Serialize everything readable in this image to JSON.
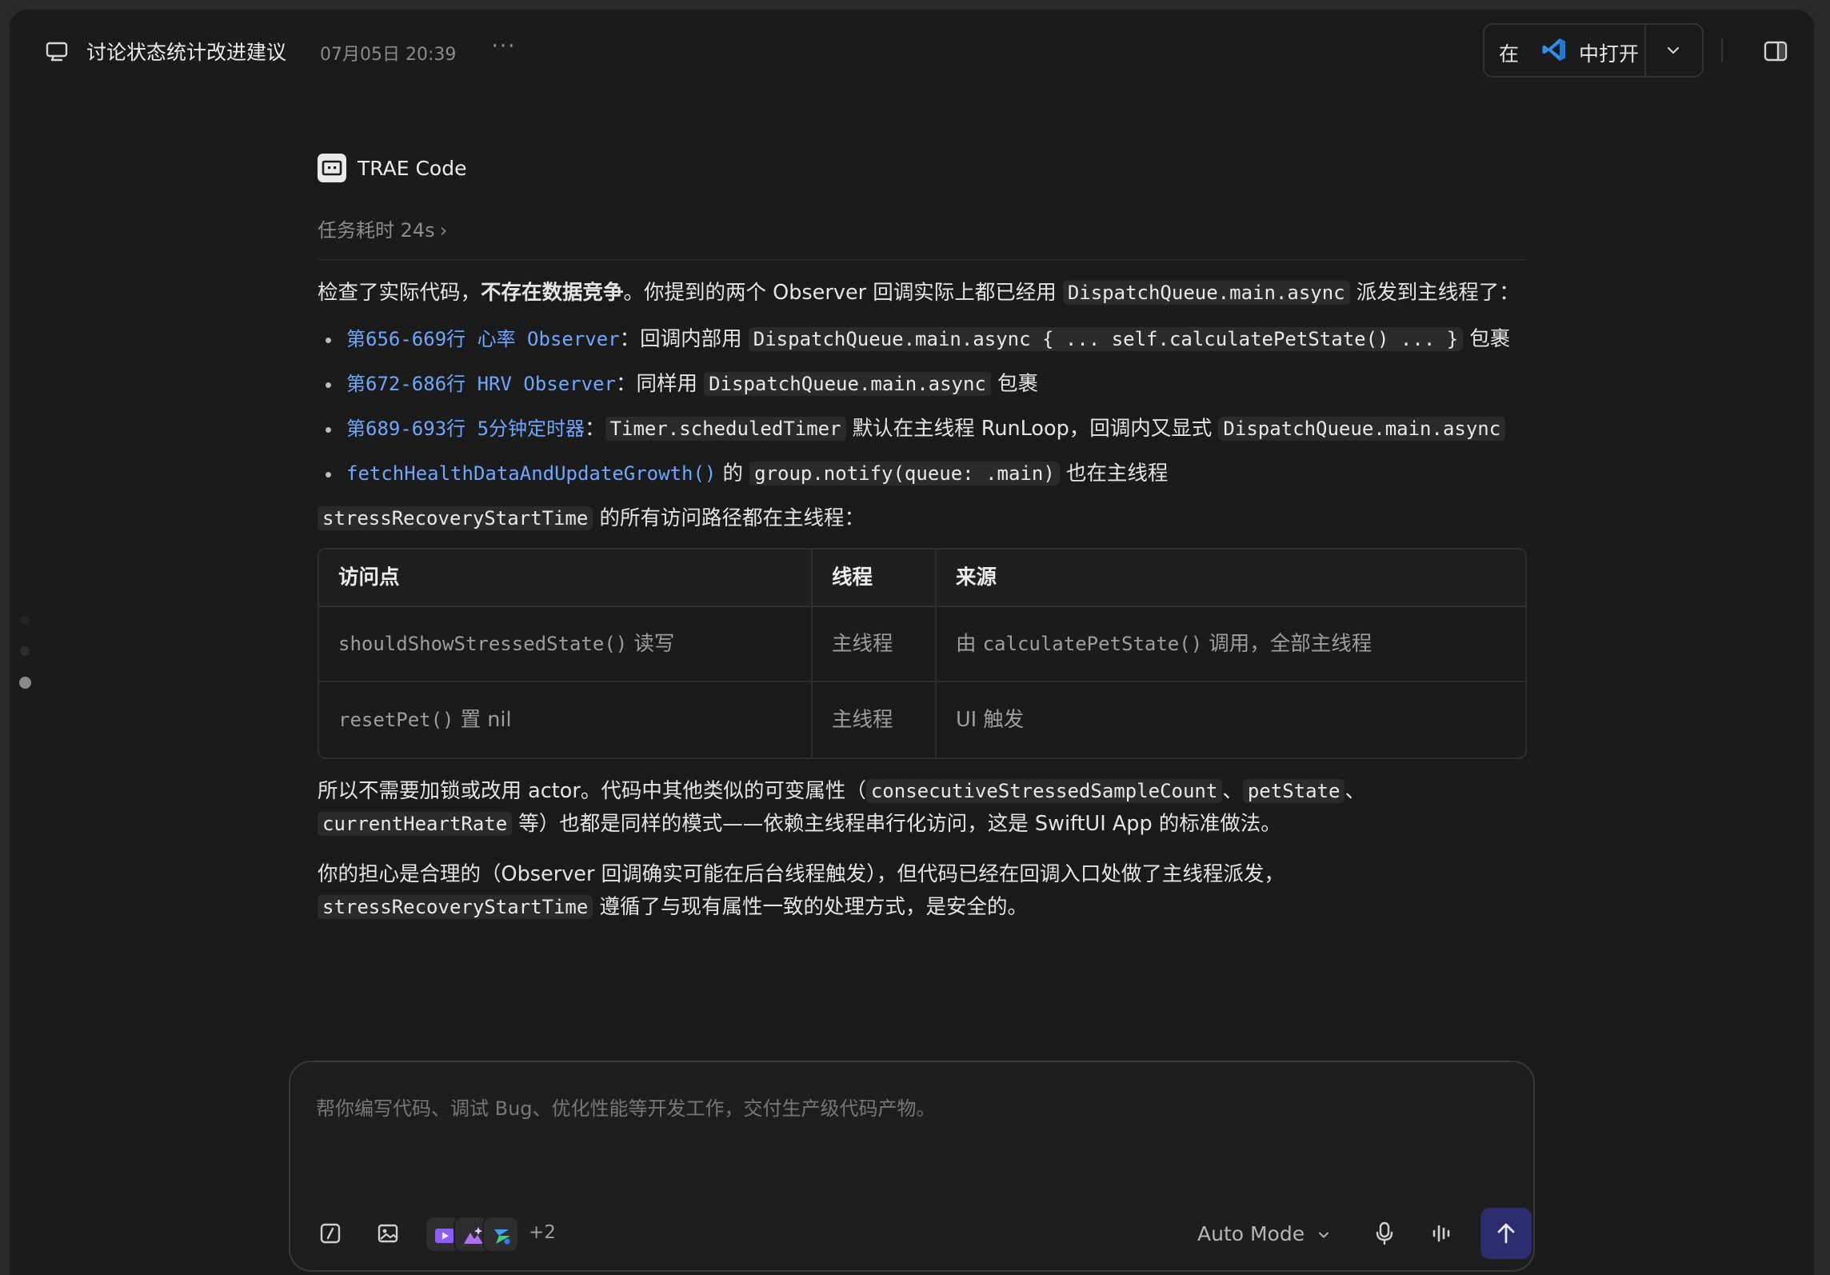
{
  "header": {
    "title": "讨论状态统计改进建议",
    "timestamp": "07月05日 20:39",
    "more_label": "···",
    "open_in_prefix": "在",
    "open_in_suffix": "中打开",
    "open_in_app_icon": "vscode-icon"
  },
  "agent": {
    "name": "TRAE Code",
    "task_time": "任务耗时 24s",
    "task_time_chevron": "›"
  },
  "message": {
    "intro_1": "检查了实际代码，",
    "intro_bold": "不存在数据竞争",
    "intro_2": "。你提到的两个 Observer 回调实际上都已经用 ",
    "intro_code": "DispatchQueue.main.async",
    "intro_3": " 派发到主线程了：",
    "bullets": [
      {
        "link": "第656-669行 心率 Observer",
        "sep": "：",
        "text_1": "回调内部用 ",
        "code_1": "DispatchQueue.main.async { ... self.calculatePetState() ... }",
        "text_2": " 包裹"
      },
      {
        "link": "第672-686行 HRV Observer",
        "sep": "：",
        "text_1": "同样用 ",
        "code_1": "DispatchQueue.main.async",
        "text_2": " 包裹"
      },
      {
        "link": "第689-693行 5分钟定时器",
        "sep": "：",
        "code_1": "Timer.scheduledTimer",
        "text_1": " 默认在主线程 RunLoop，回调内又显式 ",
        "code_2": "DispatchQueue.main.async"
      },
      {
        "link": "fetchHealthDataAndUpdateGrowth()",
        "text_1": " 的 ",
        "code_1": "group.notify(queue: .main)",
        "text_2": " 也在主线程"
      }
    ],
    "para2_code": "stressRecoveryStartTime",
    "para2_text": " 的所有访问路径都在主线程：",
    "table": {
      "headers": [
        "访问点",
        "线程",
        "来源"
      ],
      "rows": [
        {
          "a_code": "shouldShowStressedState()",
          "a_text": " 读写",
          "b": "主线程",
          "c_pre": "由 ",
          "c_code": "calculatePetState()",
          "c_post": " 调用，全部主线程"
        },
        {
          "a_code": "resetPet()",
          "a_text": " 置 nil",
          "b": "主线程",
          "c_pre": "UI 触发",
          "c_code": "",
          "c_post": ""
        }
      ]
    },
    "para3_1": "所以不需要加锁或改用 actor。代码中其他类似的可变属性（",
    "para3_code1": "consecutiveStressedSampleCount",
    "para3_sep1": "、",
    "para3_code2": "petState",
    "para3_sep2": "、",
    "para3_code3": "currentHeartRate",
    "para3_2": " 等）也都是同样的模式——依赖主线程串行化访问，这是 SwiftUI App 的标准做法。",
    "para4_1": "你的担心是合理的（Observer 回调确实可能在后台线程触发），但代码已经在回调入口处做了主线程派发，",
    "para4_code": "stressRecoveryStartTime",
    "para4_2": " 遵循了与现有属性一致的处理方式，是安全的。"
  },
  "input": {
    "placeholder": "帮你编写代码、调试 Bug、优化性能等开发工作，交付生产级代码产物。",
    "extra_count": "+2",
    "mode": "Auto Mode"
  },
  "colors": {
    "background": "#1b1b1c",
    "link": "#6fa7ff",
    "send_button": "#2d2d6e"
  }
}
